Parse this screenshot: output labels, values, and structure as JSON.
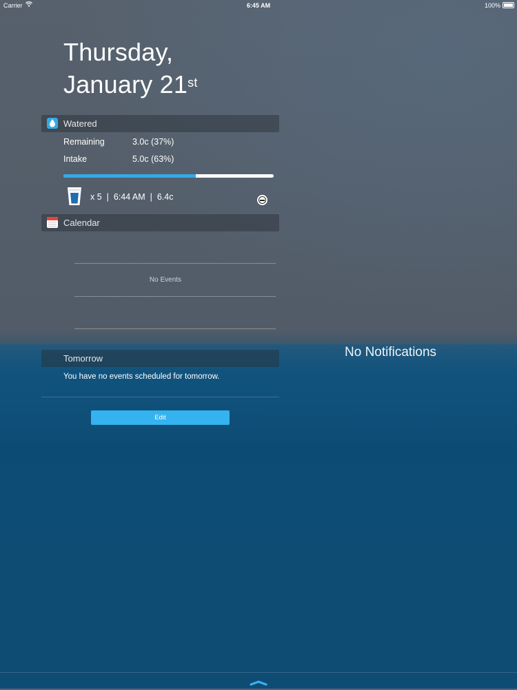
{
  "status_bar": {
    "carrier": "Carrier",
    "wifi_icon": "wifi-icon",
    "time": "6:45 AM",
    "battery": "100%"
  },
  "date": {
    "line1": "Thursday,",
    "line2": "January 21",
    "suffix": "st"
  },
  "watered": {
    "title": "Watered",
    "icon": "water-drop-icon",
    "remaining_label": "Remaining",
    "remaining_value": "3.0c (37%)",
    "intake_label": "Intake",
    "intake_value": "5.0c (63%)",
    "progress_fraction": 0.63,
    "last_drink": "x 5  |  6:44 AM  |  6.4c",
    "glass_icon": "glass-icon",
    "remove_icon": "minus-circle-icon",
    "accent_color": "#34a9e8"
  },
  "calendar": {
    "title": "Calendar",
    "icon": "calendar-icon",
    "no_events": "No Events"
  },
  "tomorrow": {
    "title": "Tomorrow",
    "message": "You have no events scheduled for tomorrow."
  },
  "edit": {
    "label": "Edit"
  },
  "notifications": {
    "empty_label": "No Notifications"
  },
  "grabber_icon": "chevron-up-icon"
}
